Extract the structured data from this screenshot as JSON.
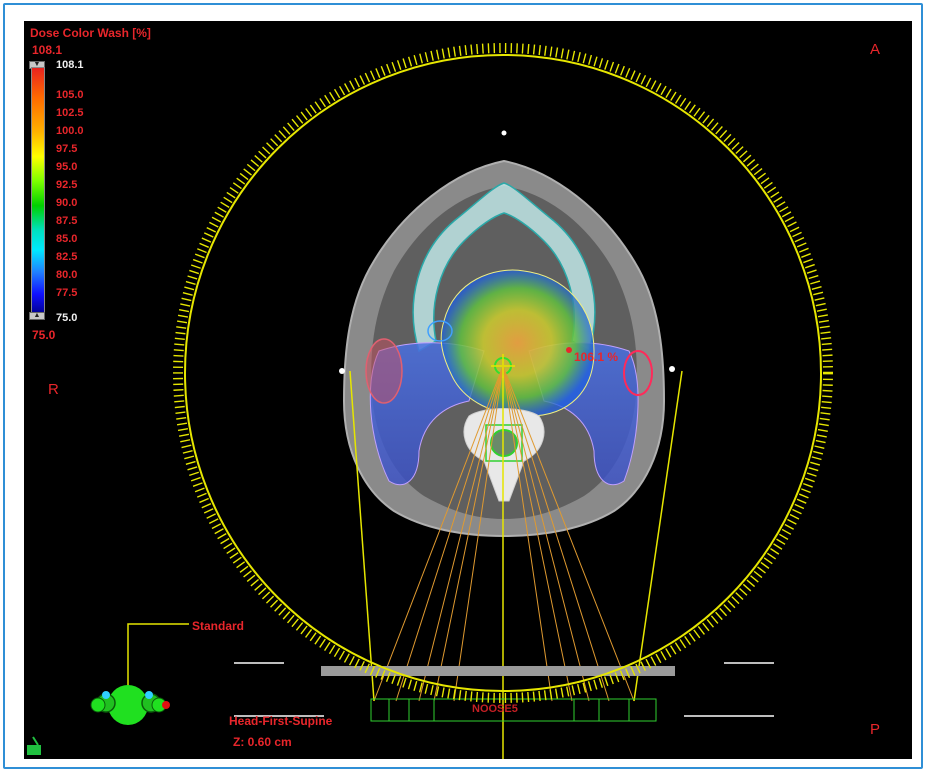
{
  "colorbar": {
    "title": "Dose Color Wash [%]",
    "max_label": "108.1",
    "max_value_label": "108.1",
    "min_label": "75.0",
    "min_value_label": "75.0",
    "ticks": [
      "105.0",
      "102.5",
      "100.0",
      "97.5",
      "95.0",
      "92.5",
      "90.0",
      "87.5",
      "85.0",
      "82.5",
      "80.0",
      "77.5"
    ]
  },
  "orientation": {
    "right": "R",
    "anterior": "A",
    "posterior": "P"
  },
  "hotspot_label": "106.1 %",
  "view_label": "Standard",
  "patient_position": "Head-First-Supine",
  "slice_position": "Z: 0.60 cm",
  "couch_label": "NOOSE5",
  "colors": {
    "gantry_ring": "#e6e600",
    "beam_lines": "#e09a30",
    "text_red": "#e8262b",
    "frame_border": "#2f8fd6"
  }
}
